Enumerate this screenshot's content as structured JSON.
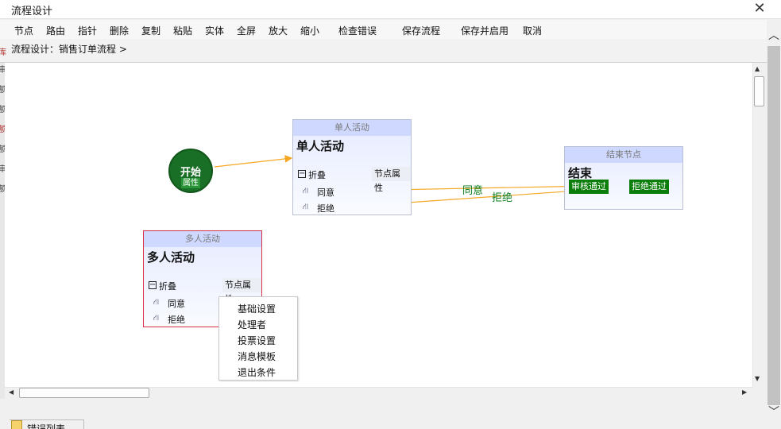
{
  "window": {
    "title": "流程设计",
    "close_glyph": "✕"
  },
  "toolbar": {
    "items": [
      "节点",
      "路由",
      "指针",
      "删除",
      "复制",
      "粘贴",
      "实体",
      "全屏",
      "放大",
      "缩小",
      "检查错误",
      "保存流程",
      "保存并启用",
      "取消"
    ]
  },
  "breadcrumb": "流程设计：销售订单流程 >",
  "left_sliver_chars": [
    "库",
    "审",
    "额",
    "额",
    "额",
    "额",
    "审",
    "额",
    "额"
  ],
  "start_node": {
    "label": "开始",
    "prop": "属性"
  },
  "single_node": {
    "header": "单人活动",
    "title": "单人活动",
    "fold": "折叠",
    "fold_glyph": "−",
    "prop": "节点属性",
    "routes": [
      "同意",
      "拒绝"
    ]
  },
  "multi_node": {
    "header": "多人活动",
    "title": "多人活动",
    "fold": "折叠",
    "fold_glyph": "−",
    "prop": "节点属性",
    "routes": [
      "同意",
      "拒绝"
    ]
  },
  "end_node": {
    "header": "结束节点",
    "title": "结束",
    "badges": [
      "审核通过",
      "拒绝通过"
    ]
  },
  "edge_labels": {
    "agree": "同意",
    "reject": "拒绝"
  },
  "context_menu": {
    "items": [
      "基础设置",
      "处理者",
      "投票设置",
      "消息模板",
      "退出条件"
    ]
  },
  "status": {
    "tab": "错误列表"
  },
  "colors": {
    "edge": "#f5a623",
    "start": "#1a6f26",
    "badge": "#0b7d0b",
    "selected_border": "#d9304a"
  },
  "icons": {
    "route": "route-icon",
    "close": "close-icon"
  }
}
